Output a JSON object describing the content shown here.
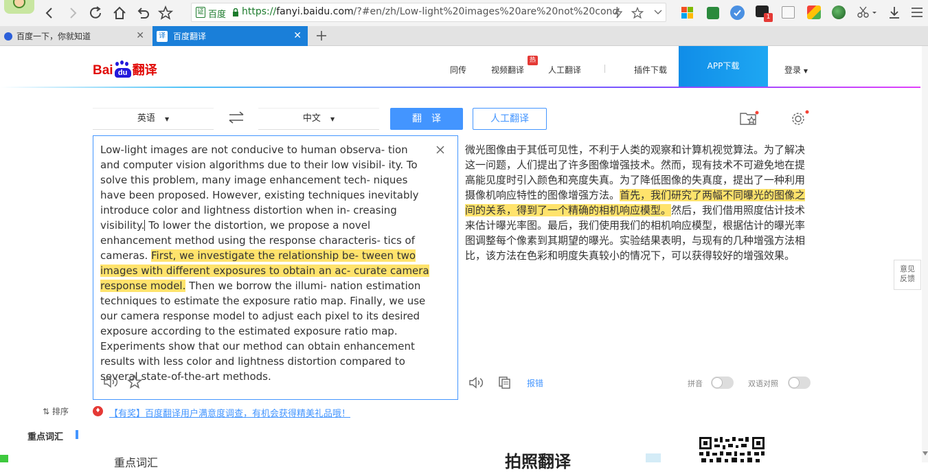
{
  "browser": {
    "badge_label": "证",
    "site_label": "百度",
    "url_scheme": "https://",
    "url_host": "fanyi.baidu.com",
    "url_rest": "/?#en/zh/Low-light%20images%20are%20not%20cond",
    "notification_count": "1",
    "tabs": [
      {
        "title": "百度一下，你就知道",
        "active": false
      },
      {
        "title": "百度翻译",
        "active": true,
        "icon_text": "译"
      }
    ]
  },
  "header": {
    "logo_bai": "Bai",
    "logo_du": "du",
    "logo_product": "翻译",
    "nav": [
      "同传",
      "视频翻译",
      "人工翻译",
      "插件下载"
    ],
    "hot_badge": "热",
    "app_download": "APP下载",
    "login": "登录",
    "accent_color": "#1a8df0"
  },
  "controls": {
    "source_lang": "英语",
    "target_lang": "中文",
    "translate_btn": "翻　译",
    "human_translate_btn": "人工翻译"
  },
  "source": {
    "before": "Low-light images are not conducive to human observa- tion and computer vision algorithms due to their low visibil- ity. To solve this problem, many image enhancement tech- niques have been proposed. However, existing techniques inevitably introduce color and lightness distortion when in- creasing visibility.",
    "middle": " To lower the distortion, we propose a novel enhancement method using the response characteris- tics of cameras. ",
    "highlight": "First, we investigate the relationship be- tween two images with different exposures to obtain an ac- curate camera response model.",
    "after": " Then we borrow the illumi- nation estimation techniques to estimate the exposure ratio map. Finally, we use our camera response model to adjust each pixel to its desired exposure according to the estimated exposure ratio map. Experiments show that our method can obtain enhancement results with less color and lightness distortion compared to several state-of-the-art methods."
  },
  "target": {
    "before": "微光图像由于其低可见性，不利于人类的观察和计算机视觉算法。为了解决这一问题，人们提出了许多图像增强技术。然而，现有技术不可避免地在提高能见度时引入颜色和亮度失真。为了降低图像的失真度，提出了一种利用摄像机响应特性的图像增强方法。",
    "highlight": "首先，我们研究了两幅不同曝光的图像之间的关系，得到了一个精确的相机响应模型。",
    "after": "然后，我们借用照度估计技术来估计曝光率图。最后，我们使用我们的相机响应模型，根据估计的曝光率图调整每个像素到其期望的曝光。实验结果表明，与现有的几种增强方法相比，该方法在色彩和明度失真较小的情况下，可以获得较好的增强效果。",
    "report": "报错",
    "pinyin": "拼音",
    "bilingual": "双语对照"
  },
  "feedback": "意见反馈",
  "bottom": {
    "sort": "排序",
    "promo": "【有奖】百度翻译用户满意度调查，有机会获得精美礼品哦！",
    "keywords": "重点词汇",
    "keywords_small": "重点词汇",
    "photo_translate": "拍照翻译"
  }
}
